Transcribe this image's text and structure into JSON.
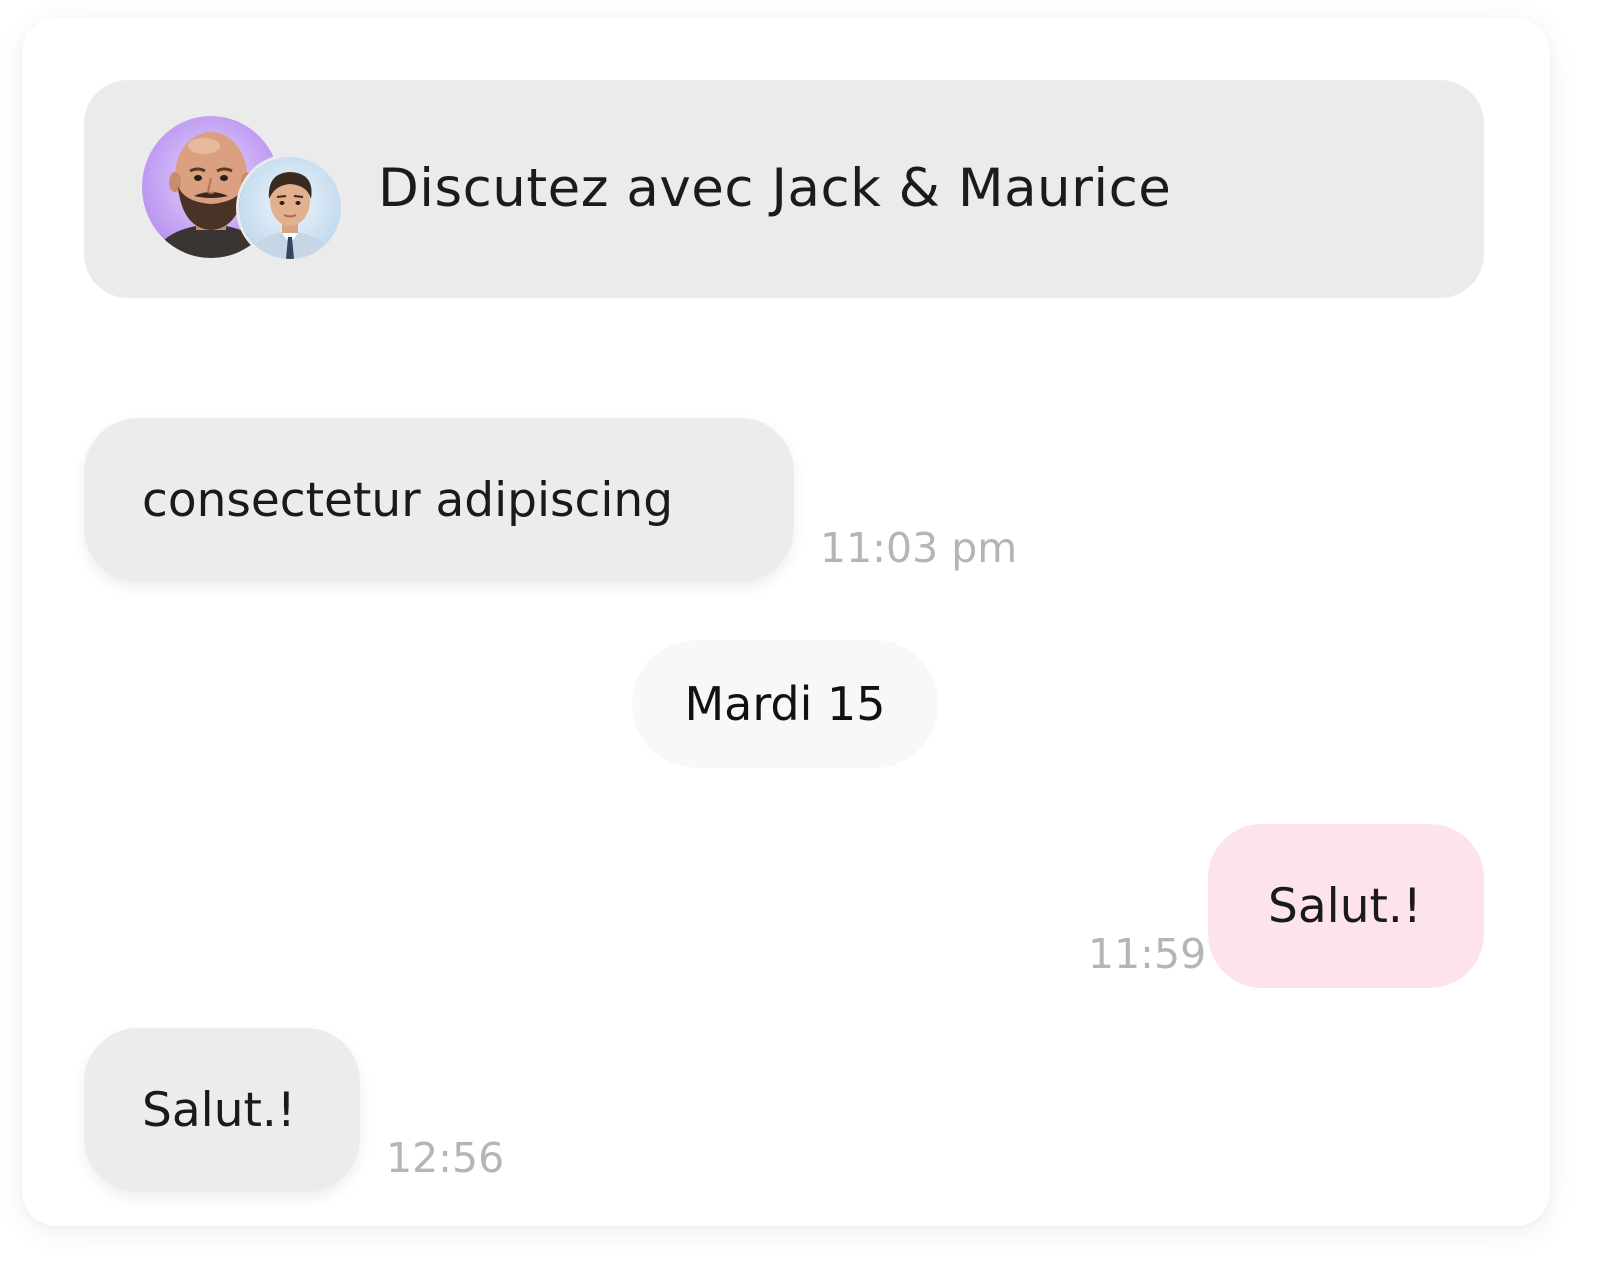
{
  "header": {
    "title": "Discutez avec Jack & Maurice",
    "avatars": [
      {
        "name": "Jack",
        "icon": "avatar-bald-bearded-man",
        "ring_color": "#c9a8f5"
      },
      {
        "name": "Maurice",
        "icon": "avatar-man-in-suit",
        "ring_color": "#cfe3f3"
      }
    ]
  },
  "messages": [
    {
      "direction": "incoming",
      "text": "consectetur adipiscing",
      "time": "11:03 pm"
    },
    {
      "direction": "outgoing",
      "text": "Salut.!",
      "time": "11:59"
    },
    {
      "direction": "incoming",
      "text": "Salut.!",
      "time": "12:56"
    }
  ],
  "date_separator": "Mardi 15",
  "colors": {
    "incoming_bubble": "#ececec",
    "outgoing_bubble": "#fde3ea",
    "header_bg": "#ebebeb",
    "timestamp": "#b5b5b5"
  }
}
